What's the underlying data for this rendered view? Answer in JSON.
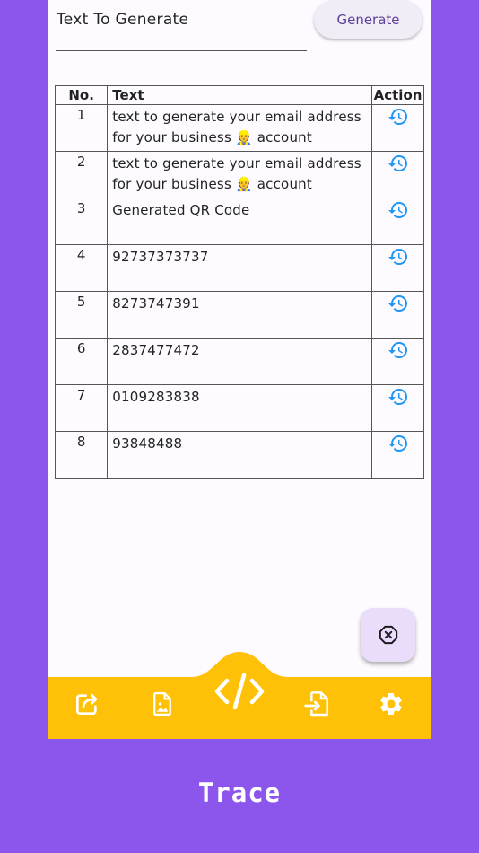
{
  "input": {
    "placeholder": "Text To Generate"
  },
  "generate_button": {
    "label": "Generate"
  },
  "table": {
    "headers": {
      "no": "No.",
      "text": "Text",
      "action": "Action"
    },
    "rows": [
      {
        "no": "1",
        "text": "text to generate your email address for your business 👷 account"
      },
      {
        "no": "2",
        "text": "text to generate your email address for your business 👷 account"
      },
      {
        "no": "3",
        "text": "Generated QR Code"
      },
      {
        "no": "4",
        "text": "92737373737"
      },
      {
        "no": "5",
        "text": "8273747391"
      },
      {
        "no": "6",
        "text": "2837477472"
      },
      {
        "no": "7",
        "text": "0109283838"
      },
      {
        "no": "8",
        "text": "93848488"
      }
    ],
    "action_icon": "history-restore-icon"
  },
  "fab": {
    "icon": "close-octagon-icon"
  },
  "bottom_nav": {
    "items": [
      {
        "icon": "share-icon"
      },
      {
        "icon": "image-icon"
      },
      {
        "icon": "code-icon",
        "active": true
      },
      {
        "icon": "file-import-icon"
      },
      {
        "icon": "settings-gear-icon"
      }
    ],
    "color": "#ffc107"
  },
  "colors": {
    "background": "#8c56ec",
    "accent_blue": "#2196f3",
    "nav_yellow": "#ffc107"
  },
  "footer": {
    "title": "Trace"
  }
}
